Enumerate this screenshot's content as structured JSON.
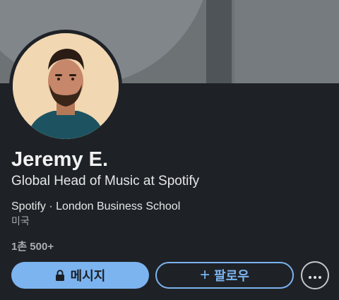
{
  "profile": {
    "name": "Jeremy E.",
    "headline": "Global Head of Music at Spotify",
    "organizations": "Spotify · London Business School",
    "location": "미국",
    "connections": "1촌 500+"
  },
  "actions": {
    "message_label": "메시지",
    "message_icon": "lock-icon",
    "follow_label": "팔로우",
    "follow_icon": "plus-icon",
    "more_icon": "more-icon"
  },
  "colors": {
    "background": "#1e2227",
    "accent": "#7cb4ef",
    "cover": "#6d7275"
  }
}
